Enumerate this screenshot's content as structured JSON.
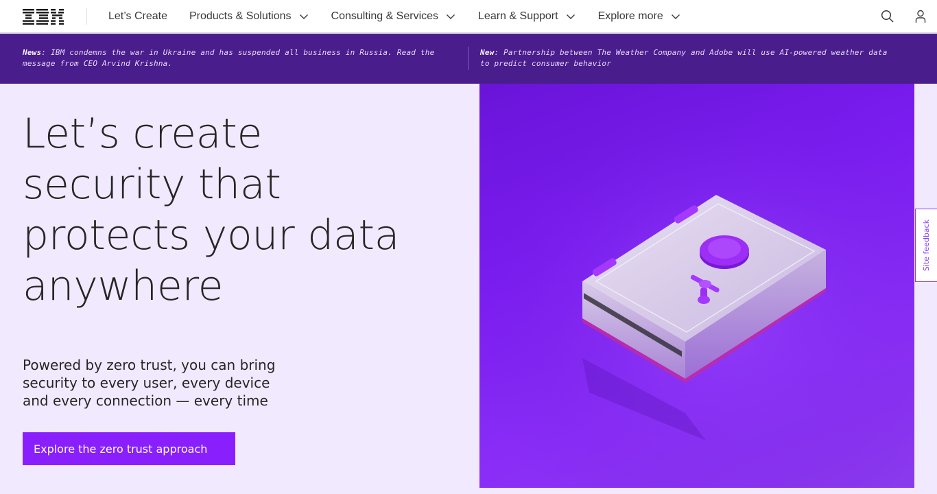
{
  "header": {
    "logo_text": "IBM",
    "nav": [
      {
        "label": "Let’s Create",
        "has_menu": false
      },
      {
        "label": "Products & Solutions",
        "has_menu": true
      },
      {
        "label": "Consulting & Services",
        "has_menu": true
      },
      {
        "label": "Learn & Support",
        "has_menu": true
      },
      {
        "label": "Explore more",
        "has_menu": true
      }
    ],
    "icons": [
      "search-icon",
      "user-icon"
    ]
  },
  "news": {
    "left": {
      "tag": "News",
      "text": ": IBM condemns the war in Ukraine and has suspended all business in Russia. Read the message from CEO Arvind Krishna."
    },
    "right": {
      "tag": "New",
      "text": ": Partnership between The Weather Company and Adobe will use AI-powered weather data to predict consumer behavior"
    }
  },
  "hero": {
    "title": "Let’s create security that protects your data anywhere",
    "subtitle": "Powered by zero trust, you can bring security to every user, every device and every connection — every time",
    "cta_label": "Explore the zero trust approach"
  },
  "feedback": {
    "label": "Site feedback"
  },
  "colors": {
    "banner": "#491d8b",
    "hero_bg": "#f1e9fe",
    "cta": "#8a1ffd",
    "image_bg": "#7a1cf0"
  }
}
